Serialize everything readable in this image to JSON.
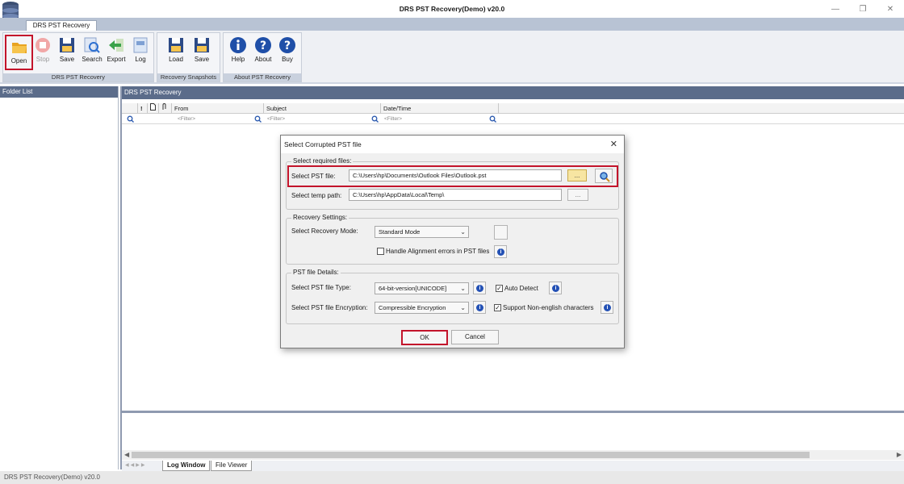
{
  "window": {
    "title": "DRS PST Recovery(Demo) v20.0"
  },
  "ribbon": {
    "tab": "DRS PST Recovery",
    "groups": {
      "main": {
        "label": "DRS PST Recovery",
        "buttons": [
          "Open",
          "Stop",
          "Save",
          "Search",
          "Export",
          "Log"
        ]
      },
      "snapshots": {
        "label": "Recovery Snapshots",
        "buttons": [
          "Load",
          "Save"
        ]
      },
      "about": {
        "label": "About PST Recovery",
        "buttons": [
          "Help",
          "About",
          "Buy"
        ]
      }
    }
  },
  "folder_panel": {
    "header": "Folder List"
  },
  "main_panel": {
    "header": "DRS PST Recovery",
    "columns": [
      "!",
      "From",
      "Subject",
      "Date/Time"
    ],
    "filter_placeholder": "<Filter>"
  },
  "bottom_tabs": [
    "Log Window",
    "File Viewer"
  ],
  "status": "DRS PST Recovery(Demo) v20.0",
  "dialog": {
    "title": "Select Corrupted PST file",
    "required": {
      "legend": "Select required files:",
      "pst_label": "Select PST file:",
      "pst_value": "C:\\Users\\hp\\Documents\\Outlook Files\\Outlook.pst",
      "temp_label": "Select temp path:",
      "temp_value": "C:\\Users\\hp\\AppData\\Local\\Temp\\",
      "browse": "..."
    },
    "recovery": {
      "legend": "Recovery Settings:",
      "mode_label": "Select Recovery Mode:",
      "mode_value": "Standard Mode",
      "align_label": "Handle Alignment errors in PST files"
    },
    "details": {
      "legend": "PST file Details:",
      "type_label": "Select PST file Type:",
      "type_value": "64-bit-version[UNICODE]",
      "auto_detect": "Auto Detect",
      "enc_label": "Select PST file Encryption:",
      "enc_value": "Compressible Encryption",
      "non_english": "Support Non-english characters"
    },
    "ok": "OK",
    "cancel": "Cancel"
  },
  "colors": {
    "highlight": "#c3142b",
    "header": "#5b6c8a",
    "info": "#2451b5"
  }
}
